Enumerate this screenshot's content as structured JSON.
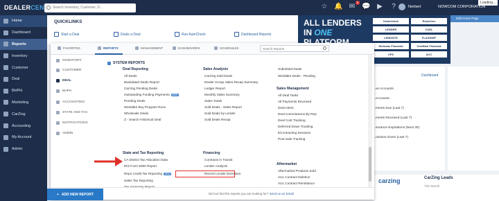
{
  "header": {
    "logo_main": "DEALER",
    "logo_accent": "CENTER",
    "search_placeholder": "Search Inventory, Customer, D...",
    "badge_count": "6",
    "user_name": "Norbert",
    "org_name": "NOWCOM CORPORATION",
    "loading": "Loading..."
  },
  "nav": {
    "items": [
      {
        "label": "Home"
      },
      {
        "label": "Dashboard"
      },
      {
        "label": "Reports"
      },
      {
        "label": "Inventory"
      },
      {
        "label": "Customer"
      },
      {
        "label": "Deal"
      },
      {
        "label": "BHPH"
      },
      {
        "label": "Marketing"
      },
      {
        "label": "CarZing"
      },
      {
        "label": "Accounting"
      },
      {
        "label": "My Account"
      },
      {
        "label": "Admin"
      }
    ]
  },
  "quicklinks": {
    "title": "QUICKLINKS",
    "items": [
      "Start a Deal",
      "Deals a Deal",
      "Run AutoCheck",
      "Dashboard Reports"
    ]
  },
  "banner": {
    "line1": "ALL LENDERS",
    "line2a": "IN ",
    "line2b": "ONE",
    "line3": "PLATFORM",
    "logos": [
      "Dealertrack",
      "RouteOne",
      "LENDER",
      "CUDL",
      "LENDSITE",
      "FLAGSHIP",
      "Nicholas Financial",
      "OneMain Financial",
      "CPS",
      "ACC"
    ],
    "view_page": "Edit Home Page"
  },
  "right_panel": {
    "dashboard_link": "Dashboard",
    "items": [
      "...ve Accounts",
      "...Accounts",
      "...ments Due (Last 7)",
      "...ments Received (Last 7)",
      "...surance Expirations (Next 30)",
      "...ontions Given (Last 7)"
    ]
  },
  "carzing": {
    "logo": "carzing",
    "title": "CarZing Leads",
    "subtitle": "This Month"
  },
  "dropdown": {
    "tabs": [
      "FAVORITES",
      "REPORTS",
      "MANAGEMENT",
      "DASHBOARDS",
      "SCHEDULES"
    ],
    "search_placeholder": "Search Reports",
    "categories": [
      "INVENTORY",
      "CUSTOMER",
      "DEAL",
      "BHPH",
      "ACCOUNTING",
      "STATE AND TAX",
      "NOTIFICATIONS",
      "ADMIN"
    ],
    "system_title": "SYSTEM REPORTS",
    "sections": {
      "deal_reporting": {
        "title": "Deal Reporting",
        "items": [
          "All Deals",
          "Backdated Deals Report",
          "Carzing Pending Deals",
          "Outstanding Funding Payments",
          "Pending Deals",
          "Westlake Buy Program Runs",
          "Wholesale Deals",
          "Z - Search Historical Deal"
        ]
      },
      "state_tax": {
        "title": "State and Tax Reporting",
        "items": [
          "CA District Tax Allocation Data",
          "IRS Form 8300 Report",
          "Repo Credit Tax Reporting",
          "Sales Tax Reporting",
          "Tax Summary Report"
        ]
      },
      "sales_analysis": {
        "title": "Sales Analysis",
        "items": [
          "Carzing Sold Deals",
          "Dealer Group Sales Recap Summary",
          "Ledger Report",
          "Monthly Sales Summary",
          "Sales Totals",
          "Sold Deals - Sales Report",
          "Sold Deals by Lender",
          "Sold Deals Recap"
        ]
      },
      "financing": {
        "title": "Financing",
        "items": [
          "Contracts in Transit",
          "Lender Analysis",
          "Recent Lender Decisions"
        ]
      },
      "misc": {
        "items": [
          "Submitted Deals",
          "Westlake Deals - Pending"
        ]
      },
      "sales_mgmt": {
        "title": "Sales Management",
        "items": [
          "All Deal Tasks",
          "All Payments Received",
          "Deal Alerts",
          "Deal Commissions By Rep",
          "Deal Cost Tracking",
          "Deferred Down Tracking",
          "EContracting Sessions",
          "Post-Sale Tracking"
        ]
      },
      "aftermarket": {
        "title": "Aftermarket",
        "items": [
          "Aftermarket Products Sold",
          "AUL Contract Deletion",
          "AUL Contract Remittance"
        ]
      }
    },
    "new_badge": "NEW",
    "add_new": "ADD NEW REPORT",
    "footer_text": "Did not find the reports you are looking for?",
    "footer_link": "Send us an Email"
  }
}
